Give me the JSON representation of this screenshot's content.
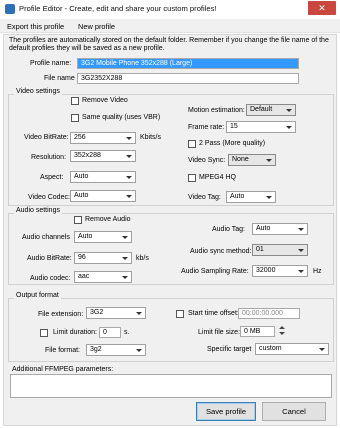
{
  "window": {
    "title": "Profile Editor - Create, edit and share your custom profiles!",
    "close_glyph": "✕"
  },
  "menu": {
    "export": "Export this profile",
    "new": "New profile"
  },
  "info_text": "The profiles are automatically stored on the default folder. Remember if you change the file name of the default profiles they will be saved as a new profile.",
  "profile": {
    "name_label": "Profile name:",
    "name_value": "3G2 Mobile Phone 352x288 (Large)",
    "file_label": "File name",
    "file_value": "3G2352X288"
  },
  "video": {
    "section": "Video settings",
    "remove_video": "Remove Video",
    "same_quality": "Same quality (uses VBR)",
    "bitrate_label": "Video BitRate:",
    "bitrate_value": "256",
    "bitrate_unit": "Kbits/s",
    "resolution_label": "Resolution:",
    "resolution_value": "352x288",
    "aspect_label": "Aspect:",
    "aspect_value": "Auto",
    "codec_label": "Video Codec:",
    "codec_value": "Auto",
    "motion_label": "Motion estimation:",
    "motion_value": "Default",
    "framerate_label": "Frame rate:",
    "framerate_value": "15",
    "twopass": "2 Pass (More quality)",
    "sync_label": "Video Sync:",
    "sync_value": "None",
    "mpeg4hq": "MPEG4 HQ",
    "tag_label": "Video Tag:",
    "tag_value": "Auto"
  },
  "audio": {
    "section": "Audio settings",
    "remove_audio": "Remove Audio",
    "channels_label": "Audio channels",
    "channels_value": "Auto",
    "bitrate_label": "Audio BitRate:",
    "bitrate_value": "96",
    "bitrate_unit": "kb/s",
    "codec_label": "Audio codec:",
    "codec_value": "aac",
    "tag_label": "Audio Tag:",
    "tag_value": "Auto",
    "sync_label": "Audio sync method:",
    "sync_value": "01",
    "sampling_label": "Audio Sampling Rate:",
    "sampling_value": "32000",
    "sampling_unit": "Hz"
  },
  "output": {
    "section": "Output format",
    "extension_label": "File extension:",
    "extension_value": "3G2",
    "limit_duration": "Limit duration:",
    "duration_value": "0",
    "duration_unit": "s.",
    "format_label": "File format:",
    "format_value": "3g2",
    "start_offset": "Start time offset:",
    "start_value": "00:00:00.000",
    "filesize_label": "Limit file size:",
    "filesize_value": "0 MB",
    "target_label": "Specific target",
    "target_value": "custom"
  },
  "ffmpeg": {
    "label": "Additional FFMPEG parameters:",
    "value": ""
  },
  "buttons": {
    "save": "Save profile",
    "cancel": "Cancel"
  }
}
